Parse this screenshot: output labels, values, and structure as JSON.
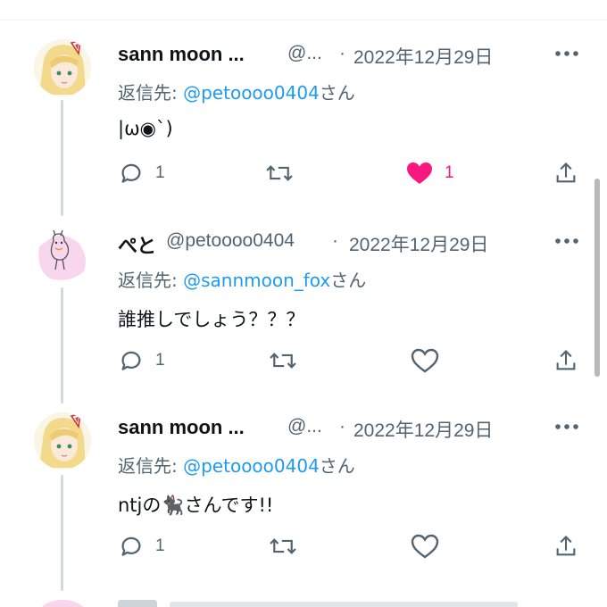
{
  "tweets": [
    {
      "name": "sann moon ...",
      "handle": "@...",
      "separator": "·",
      "date": "2022年12月29日",
      "reply_prefix": "返信先: ",
      "reply_to": "@petoooo0404",
      "reply_suffix": "さん",
      "text": "|ω◉`)",
      "reply_count": "1",
      "like_count": "1",
      "liked": true,
      "avatar": "fox-girl-avatar"
    },
    {
      "name": "ぺと",
      "handle": "@petoooo0404",
      "separator": "·",
      "date": "2022年12月29日",
      "reply_prefix": "返信先: ",
      "reply_to": "@sannmoon_fox",
      "reply_suffix": "さん",
      "text": "誰推しでしょう？？？",
      "reply_count": "1",
      "like_count": "",
      "liked": false,
      "avatar": "pink-doodle-avatar"
    },
    {
      "name": "sann moon ...",
      "handle": "@...",
      "separator": "·",
      "date": "2022年12月29日",
      "reply_prefix": "返信先: ",
      "reply_to": "@petoooo0404",
      "reply_suffix": "さん",
      "text_before": "ntjの",
      "text_emoji": "🐈‍⬛",
      "text_after": "さんです!!",
      "reply_count": "1",
      "like_count": "",
      "liked": false,
      "avatar": "fox-girl-avatar"
    }
  ],
  "colors": {
    "link": "#1d9bf0",
    "muted": "#536471",
    "like": "#f91880",
    "text": "#0f1419",
    "thread_line": "#cfd9de"
  },
  "icons": [
    "reply-icon",
    "retweet-icon",
    "like-icon",
    "share-icon",
    "more-icon"
  ]
}
